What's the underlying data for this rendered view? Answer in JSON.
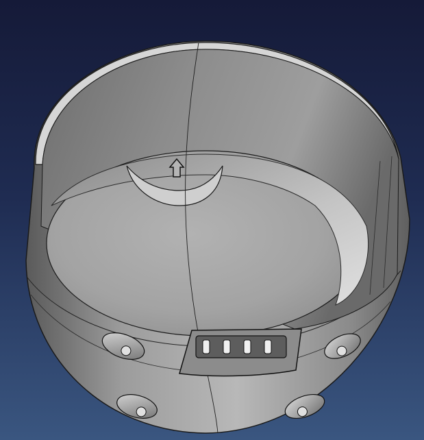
{
  "viewport": {
    "background_top": "#151a38",
    "background_bottom": "#3a5680"
  },
  "model": {
    "subject": "cad-part",
    "body_color": "#9a9a9a",
    "edge_color": "#1a1a1a",
    "features": [
      "cylindrical-wall",
      "curved-floor",
      "notch-with-arrow",
      "connector-slot-4-pins",
      "mounting-bosses"
    ],
    "connector_pin_count": 4,
    "mounting_boss_count": 4
  }
}
